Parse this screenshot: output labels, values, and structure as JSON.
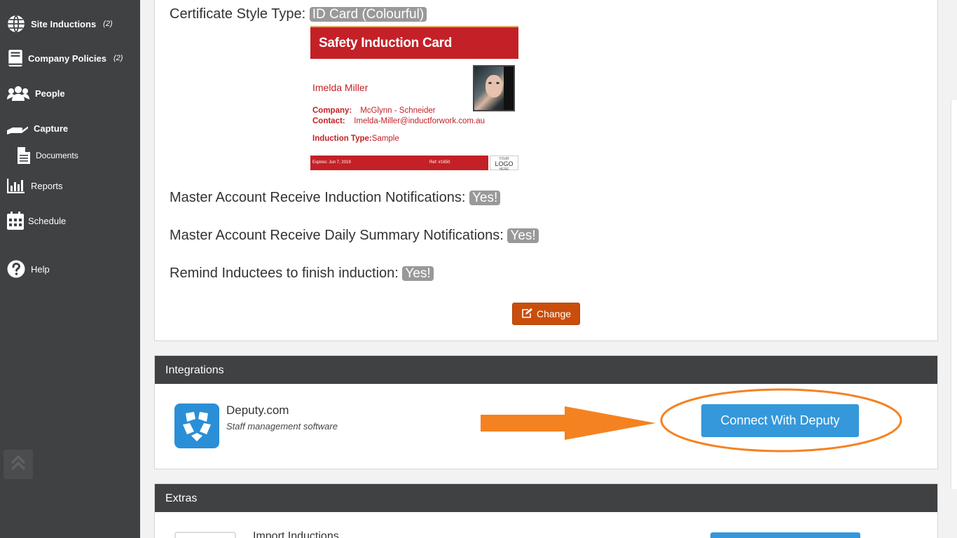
{
  "sidebar": {
    "items": [
      {
        "label": "Site Inductions",
        "count": "(2)",
        "icon": "globe-icon"
      },
      {
        "label": "Company Policies",
        "count": "(2)",
        "icon": "book-icon"
      },
      {
        "label": "People",
        "icon": "users-icon"
      },
      {
        "label": "Capture",
        "icon": "hand-icon"
      },
      {
        "label": "Documents",
        "icon": "document-icon"
      },
      {
        "label": "Reports",
        "icon": "bar-chart-icon"
      },
      {
        "label": "Schedule",
        "icon": "calendar-icon"
      },
      {
        "label": "Help",
        "icon": "question-icon"
      }
    ],
    "scroll_top_icon": "double-chevron-up-icon"
  },
  "settings": {
    "cert_style_label": "Certificate Style Type:",
    "cert_style_value": "ID Card (Colourful)",
    "induction_notif_label": "Master Account Receive Induction Notifications:",
    "induction_notif_value": "Yes!",
    "daily_summary_label": "Master Account Receive Daily Summary Notifications:",
    "daily_summary_value": "Yes!",
    "remind_label": "Remind Inductees to finish induction:",
    "remind_value": "Yes!",
    "change_button": "Change"
  },
  "id_card": {
    "title": "Safety Induction Card",
    "name": "Imelda Miller",
    "company_label": "Company:",
    "company_value": "McGlynn - Schneider",
    "contact_label": "Contact:",
    "contact_value": "Imelda-Miller@inductforwork.com.au",
    "induction_type_label": "Induction Type:",
    "induction_type_value": "Sample",
    "expires": "Expires: Jun 7, 2019",
    "ref": "Ref: #1650",
    "logo_top": "YOUR",
    "logo_mid": "LOGO",
    "logo_bottom": "HERE",
    "colors": {
      "brand_red": "#c32127"
    }
  },
  "integrations": {
    "header": "Integrations",
    "deputy_name": "Deputy.com",
    "deputy_desc": "Staff management software",
    "connect_button": "Connect With Deputy",
    "colors": {
      "button": "#3498db",
      "annotation": "#f58220"
    }
  },
  "extras": {
    "header": "Extras",
    "import_title": "Import Inductions"
  }
}
